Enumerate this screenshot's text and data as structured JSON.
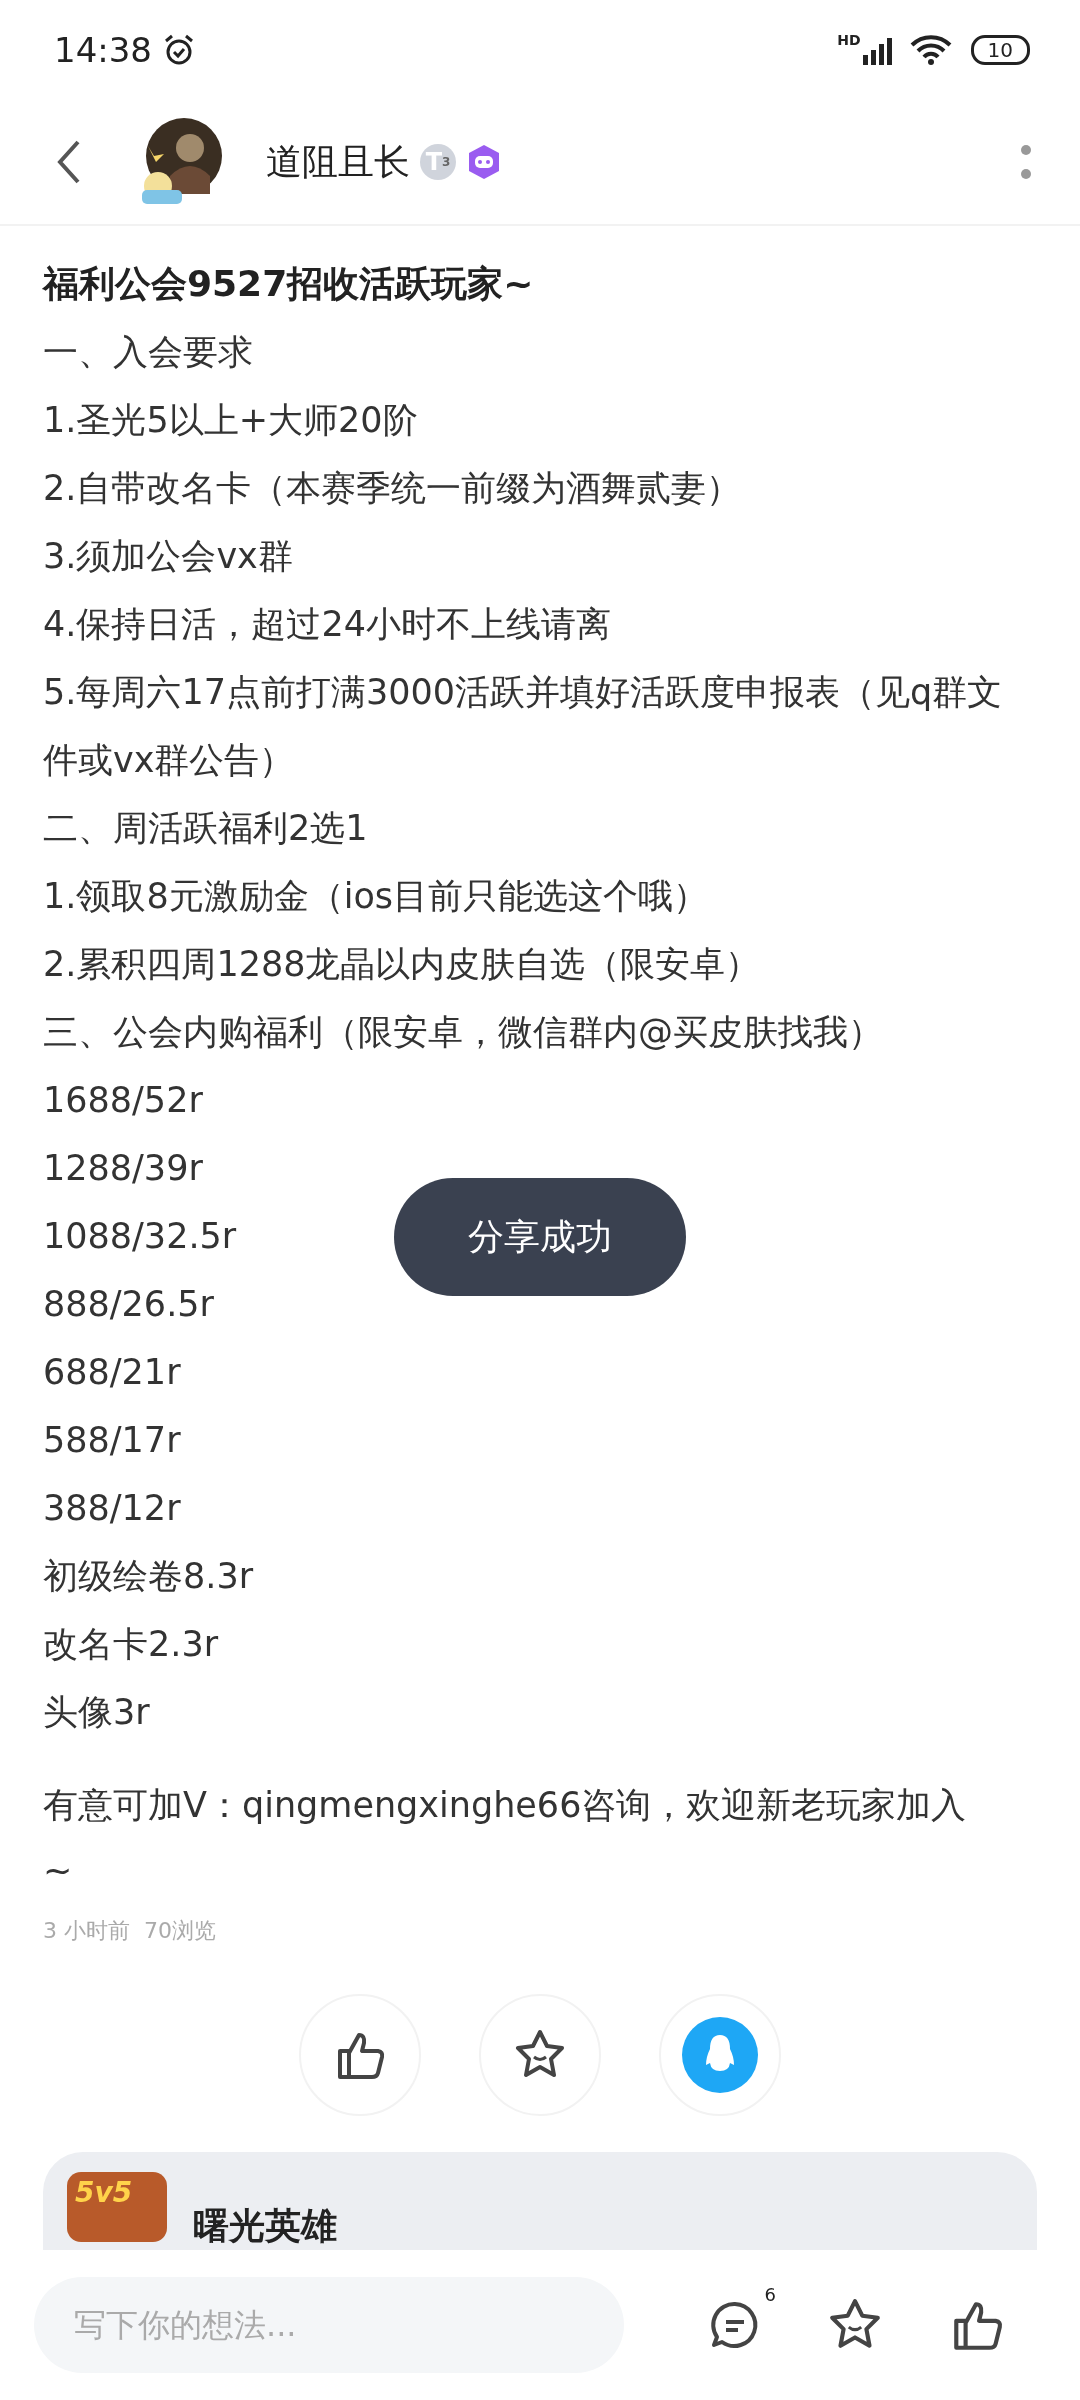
{
  "status_bar": {
    "time": "14:38",
    "network": "HD",
    "battery": "10"
  },
  "header": {
    "username": "道阻且长",
    "level_badge": {
      "letter": "T",
      "tier": "3"
    }
  },
  "post": {
    "title": "福利公会9527招收活跃玩家~",
    "lines": [
      "一、入会要求",
      "1.圣光5以上+大师20阶",
      "2.自带改名卡（本赛季统一前缀为酒舞贰妻）",
      "3.须加公会vx群",
      "4.保持日活，超过24小时不上线请离",
      "5.每周六17点前打满3000活跃并填好活跃度申报表（见q群文件或vx群公告）",
      "二、周活跃福利2选1",
      "1.领取8元激励金（ios目前只能选这个哦）",
      "2.累积四周1288龙晶以内皮肤自选（限安卓）",
      "三、公会内购福利（限安卓，微信群内@买皮肤找我）",
      "1688/52r",
      "1288/39r",
      "1088/32.5r",
      "888/26.5r",
      "688/21r",
      "588/17r",
      "388/12r",
      "初级绘卷8.3r",
      "改名卡2.3r",
      "头像3r"
    ],
    "contact": "有意可加V：qingmengxinghe66咨询，欢迎新老玩家加入~",
    "time": "3 小时前",
    "views": "70浏览"
  },
  "game_card": {
    "name": "曙光英雄",
    "icon_text": "5v5"
  },
  "toast": "分享成功",
  "bottom_bar": {
    "placeholder": "写下你的想法...",
    "comment_count": "6"
  }
}
